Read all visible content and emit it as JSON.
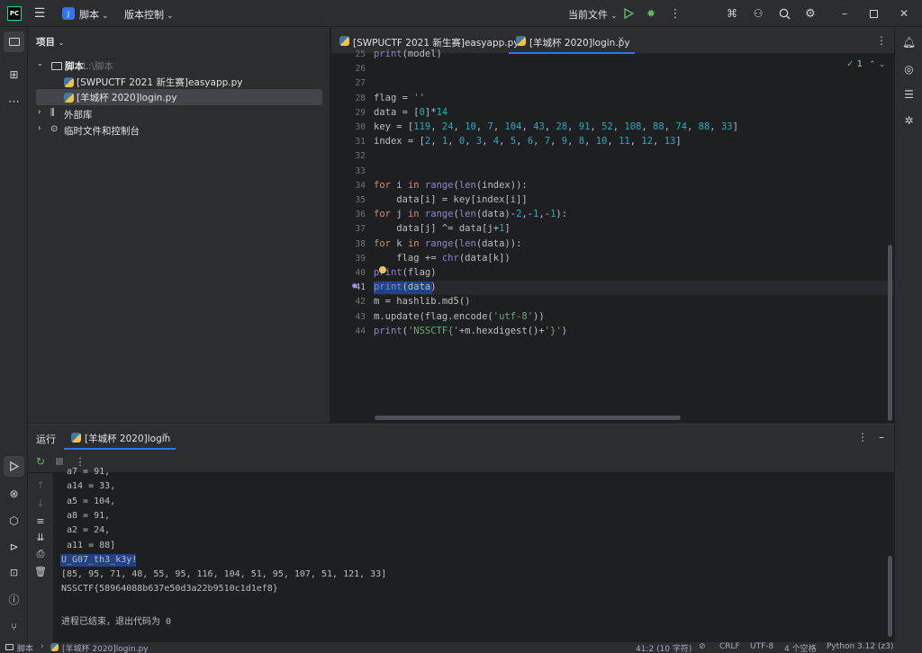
{
  "titlebar": {
    "app_logo": "PC",
    "project_name": "脚本",
    "vcs_label": "版本控制",
    "run_config": "当前文件",
    "colors": {
      "accent": "#3574f0",
      "run": "#5fb865",
      "debug": "#5fb865"
    }
  },
  "project_panel": {
    "title": "项目",
    "tree": [
      {
        "label": "脚本",
        "hint": "L:\\脚本",
        "type": "folder"
      },
      {
        "label": "[SWPUCTF 2021 新生赛]easyapp.py",
        "type": "python"
      },
      {
        "label": "[羊城杯 2020]login.py",
        "type": "python",
        "selected": true
      },
      {
        "label": "外部库",
        "type": "library"
      },
      {
        "label": "临时文件和控制台",
        "type": "scratch"
      }
    ]
  },
  "editor": {
    "tabs": [
      {
        "label": "[SWPUCTF 2021 新生赛]easyapp.py",
        "active": false
      },
      {
        "label": "[羊城杯 2020]login.py",
        "active": true
      }
    ],
    "inspection_count": "1",
    "lines": [
      {
        "n": "25",
        "code": "print(model)"
      },
      {
        "n": "26",
        "code": ""
      },
      {
        "n": "27",
        "code": ""
      },
      {
        "n": "28",
        "code": "flag = ''"
      },
      {
        "n": "29",
        "code": "data = [0]*14"
      },
      {
        "n": "30",
        "code": "key = [119, 24, 10, 7, 104, 43, 28, 91, 52, 108, 88, 74, 88, 33]"
      },
      {
        "n": "31",
        "code": "index = [2, 1, 0, 3, 4, 5, 6, 7, 9, 8, 10, 11, 12, 13]"
      },
      {
        "n": "32",
        "code": ""
      },
      {
        "n": "33",
        "code": ""
      },
      {
        "n": "34",
        "code": "for i in range(len(index)):"
      },
      {
        "n": "35",
        "code": "    data[i] = key[index[i]]"
      },
      {
        "n": "36",
        "code": "for j in range(len(data)-2,-1,-1):"
      },
      {
        "n": "37",
        "code": "    data[j] ^= data[j+1]"
      },
      {
        "n": "38",
        "code": "for k in range(len(data)):"
      },
      {
        "n": "39",
        "code": "    flag += chr(data[k])"
      },
      {
        "n": "40",
        "code": "print(flag)"
      },
      {
        "n": "41",
        "code": "print(data)"
      },
      {
        "n": "42",
        "code": "m = hashlib.md5()"
      },
      {
        "n": "43",
        "code": "m.update(flag.encode('utf-8'))"
      },
      {
        "n": "44",
        "code": "print('NSSCTF{'+m.hexdigest()+'}')"
      }
    ]
  },
  "run_panel": {
    "title": "运行",
    "tab_label": "[羊城杯 2020]login",
    "output": [
      "a7 = 91,",
      "a14 = 33,",
      "a5 = 104,",
      "a8 = 91,",
      "a2 = 24,",
      "a11 = 88]",
      "U_G07_th3_k3y!",
      "[85, 95, 71, 48, 55, 95, 116, 104, 51, 95, 107, 51, 121, 33]",
      "NSSCTF{58964088b637e50d3a22b9510c1d1ef8}",
      "",
      "进程已结束，退出代码为 0"
    ]
  },
  "status_bar": {
    "breadcrumb_root": "脚本",
    "breadcrumb_file": "[羊城杯 2020]login.py",
    "position": "41:2 (10 字符)",
    "line_sep": "CRLF",
    "encoding": "UTF-8",
    "indent": "4 个空格",
    "interpreter": "Python 3.12 (z3)"
  }
}
